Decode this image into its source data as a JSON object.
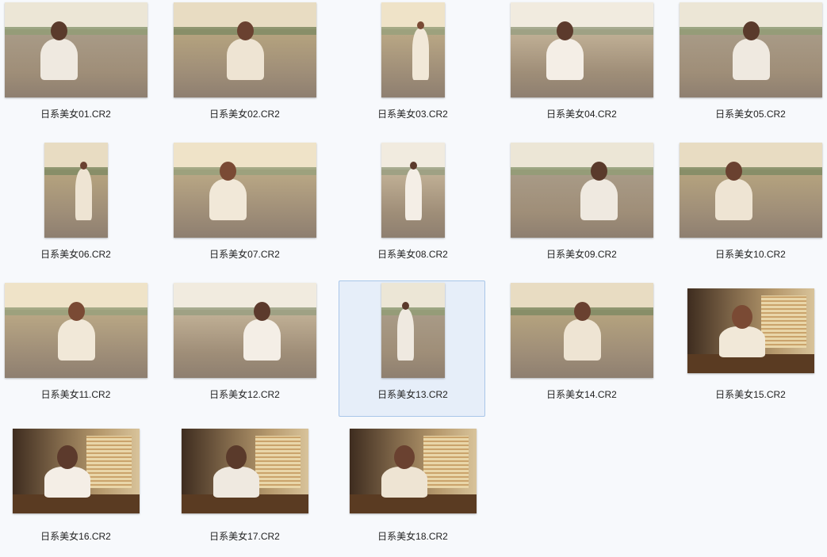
{
  "files": [
    {
      "name": "日系美女01.CR2",
      "scene": "field",
      "orientation": "landscape",
      "selected": false
    },
    {
      "name": "日系美女02.CR2",
      "scene": "field",
      "orientation": "landscape",
      "selected": false
    },
    {
      "name": "日系美女03.CR2",
      "scene": "field",
      "orientation": "portrait",
      "selected": false
    },
    {
      "name": "日系美女04.CR2",
      "scene": "field",
      "orientation": "landscape",
      "selected": false
    },
    {
      "name": "日系美女05.CR2",
      "scene": "field",
      "orientation": "landscape",
      "selected": false
    },
    {
      "name": "日系美女06.CR2",
      "scene": "field",
      "orientation": "portrait",
      "selected": false
    },
    {
      "name": "日系美女07.CR2",
      "scene": "field",
      "orientation": "landscape",
      "selected": false
    },
    {
      "name": "日系美女08.CR2",
      "scene": "field",
      "orientation": "portrait",
      "selected": false
    },
    {
      "name": "日系美女09.CR2",
      "scene": "field",
      "orientation": "landscape",
      "selected": false
    },
    {
      "name": "日系美女10.CR2",
      "scene": "field",
      "orientation": "landscape",
      "selected": false
    },
    {
      "name": "日系美女11.CR2",
      "scene": "field",
      "orientation": "landscape",
      "selected": false
    },
    {
      "name": "日系美女12.CR2",
      "scene": "field",
      "orientation": "landscape",
      "selected": false
    },
    {
      "name": "日系美女13.CR2",
      "scene": "field",
      "orientation": "portrait",
      "selected": true
    },
    {
      "name": "日系美女14.CR2",
      "scene": "field",
      "orientation": "landscape",
      "selected": false
    },
    {
      "name": "日系美女15.CR2",
      "scene": "indoor",
      "orientation": "landscape",
      "selected": false
    },
    {
      "name": "日系美女16.CR2",
      "scene": "indoor",
      "orientation": "landscape",
      "selected": false
    },
    {
      "name": "日系美女17.CR2",
      "scene": "indoor",
      "orientation": "landscape",
      "selected": false
    },
    {
      "name": "日系美女18.CR2",
      "scene": "indoor",
      "orientation": "landscape",
      "selected": false
    }
  ],
  "colors": {
    "background": "#f7f9fc",
    "selection_fill": "#e6eef9",
    "selection_border": "#a9c6e8",
    "label_text": "#222222"
  }
}
